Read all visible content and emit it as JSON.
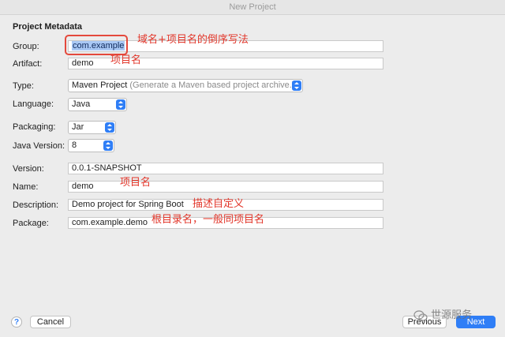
{
  "window": {
    "title": "New Project"
  },
  "section": {
    "title": "Project Metadata"
  },
  "fields": {
    "group": {
      "label": "Group:",
      "value": "com.example"
    },
    "artifact": {
      "label": "Artifact:",
      "value": "demo"
    },
    "type": {
      "label": "Type:",
      "value": "Maven Project",
      "hint": "(Generate a Maven based project archive.)"
    },
    "language": {
      "label": "Language:",
      "value": "Java"
    },
    "packaging": {
      "label": "Packaging:",
      "value": "Jar"
    },
    "java_version": {
      "label": "Java Version:",
      "value": "8"
    },
    "version": {
      "label": "Version:",
      "value": "0.0.1-SNAPSHOT"
    },
    "name": {
      "label": "Name:",
      "value": "demo"
    },
    "description": {
      "label": "Description:",
      "value": "Demo project for Spring Boot"
    },
    "package": {
      "label": "Package:",
      "value": "com.example.demo"
    }
  },
  "annotations": {
    "group": "域名+项目名的倒序写法",
    "artifact": "项目名",
    "name": "项目名",
    "description": "描述自定义",
    "package": "根目录名，一般同项目名"
  },
  "buttons": {
    "help": "?",
    "cancel": "Cancel",
    "previous": "Previous",
    "next": "Next"
  },
  "watermark": {
    "text": "世源服务"
  },
  "colors": {
    "accent": "#2f7ef6",
    "annotation": "#e2362a"
  }
}
